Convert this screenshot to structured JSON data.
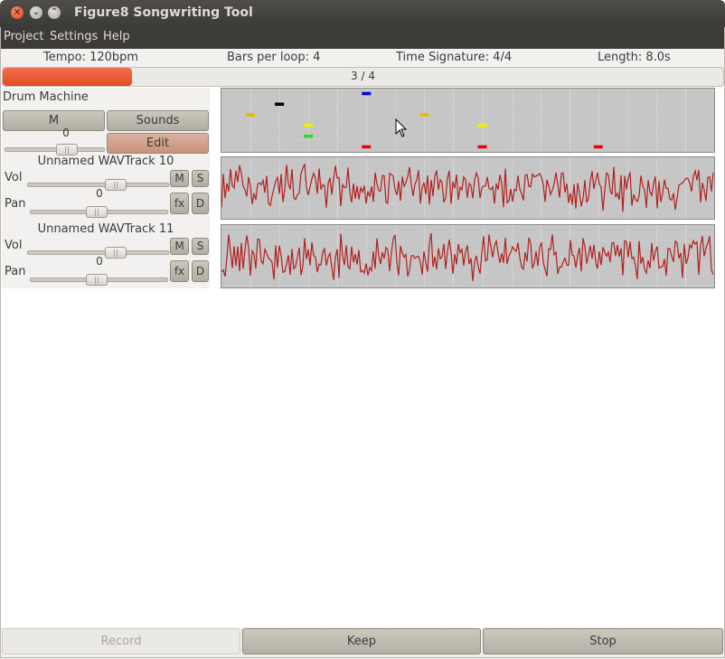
{
  "window": {
    "title": "Figure8 Songwriting Tool",
    "close_glyph": "×",
    "minimize_glyph": "⌄",
    "maximize_glyph": "⌃"
  },
  "menu": {
    "project": "Project",
    "settings": "Settings",
    "help": "Help"
  },
  "info": {
    "tempo": "Tempo: 120bpm",
    "bars": "Bars per loop: 4",
    "time_sig": "Time Signature: 4/4",
    "length": "Length: 8.0s"
  },
  "progress": {
    "text": "3 / 4",
    "fraction": 0.18
  },
  "drum": {
    "label": "Drum Machine",
    "mute": "M",
    "sounds": "Sounds",
    "edit": "Edit",
    "slider_value": "0",
    "hits": [
      {
        "step": 1,
        "row": 1,
        "color": "#f0b400"
      },
      {
        "step": 2,
        "row": 0,
        "color": "#000000"
      },
      {
        "step": 3,
        "row": 2,
        "color": "#f0f000"
      },
      {
        "step": 3,
        "row": 3,
        "color": "#22dd22"
      },
      {
        "step": 5,
        "row": -1,
        "color": "#0000ee"
      },
      {
        "step": 5,
        "row": 4,
        "color": "#ee0000"
      },
      {
        "step": 7,
        "row": 1,
        "color": "#f0b400"
      },
      {
        "step": 9,
        "row": 2,
        "color": "#f0f000"
      },
      {
        "step": 9,
        "row": 4,
        "color": "#ee0000"
      },
      {
        "step": 13,
        "row": 4,
        "color": "#ee0000"
      }
    ]
  },
  "tracks": [
    {
      "name": "Unnamed WAVTrack 10",
      "vol_label": "Vol",
      "pan_label": "Pan",
      "pan_value": "0",
      "mute": "M",
      "solo": "S",
      "fx": "fx",
      "delete": "D"
    },
    {
      "name": "Unnamed WAVTrack 11",
      "vol_label": "Vol",
      "pan_label": "Pan",
      "pan_value": "0",
      "mute": "M",
      "solo": "S",
      "fx": "fx",
      "delete": "D"
    }
  ],
  "bottom": {
    "record": "Record",
    "keep": "Keep",
    "stop": "Stop"
  },
  "colors": {
    "waveform": "#b22020",
    "graph_bg": "#c6c6c6",
    "progress_fill": "#e34a24"
  }
}
